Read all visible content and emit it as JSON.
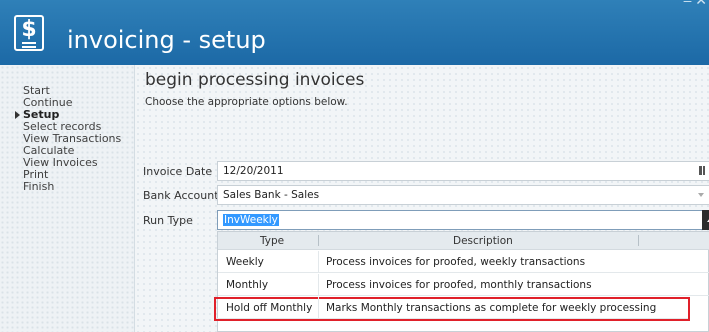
{
  "window": {
    "title": "invoicing - setup"
  },
  "sidebar": {
    "items": [
      {
        "label": "Start"
      },
      {
        "label": "Continue"
      },
      {
        "label": "Setup",
        "active": true
      },
      {
        "label": "Select records"
      },
      {
        "label": "View Transactions"
      },
      {
        "label": "Calculate"
      },
      {
        "label": "View Invoices"
      },
      {
        "label": "Print"
      },
      {
        "label": "Finish"
      }
    ]
  },
  "main": {
    "heading": "begin processing invoices",
    "subheading": "Choose the appropriate options below.",
    "form": {
      "invoice_date": {
        "label": "Invoice Date",
        "value": "12/20/2011"
      },
      "bank_account": {
        "label": "Bank Account",
        "value": "Sales Bank - Sales"
      },
      "run_type": {
        "label": "Run Type",
        "value": "InvWeekly"
      }
    },
    "dropdown": {
      "columns": [
        "Type",
        "Description"
      ],
      "rows": [
        {
          "type": "Weekly",
          "description": "Process invoices for proofed, weekly transactions"
        },
        {
          "type": "Monthly",
          "description": "Process invoices for proofed, monthly transactions"
        },
        {
          "type": "Hold off Monthly",
          "description": "Marks Monthly transactions as complete for weekly processing",
          "highlighted": true
        }
      ]
    }
  },
  "colors": {
    "titlebar": "#2579b2",
    "highlight_box": "#e0202a",
    "selection": "#3399ff"
  }
}
